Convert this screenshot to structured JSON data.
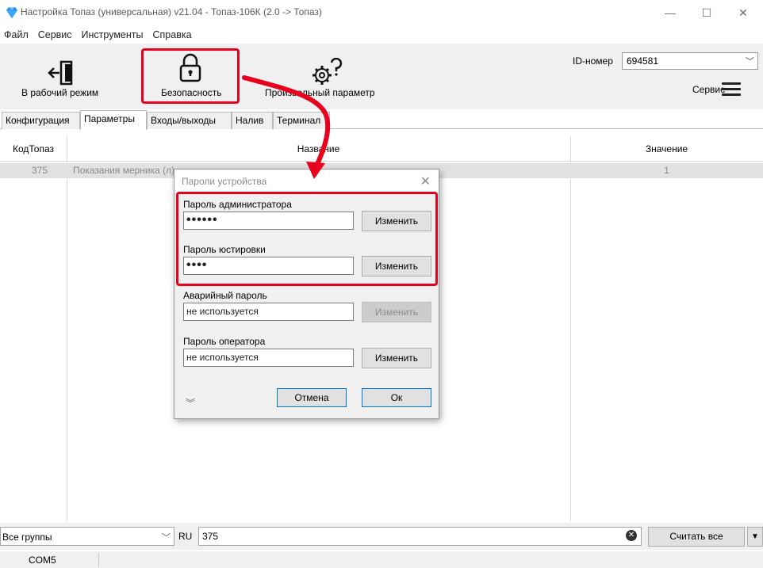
{
  "window": {
    "title": "Настройка Топаз (универсальная) v21.04 - Топаз-106К (2.0 -> Топаз)",
    "controls": {
      "minimize": "—",
      "maximize": "☐",
      "close": "✕"
    }
  },
  "menu": [
    "Файл",
    "Сервис",
    "Инструменты",
    "Справка"
  ],
  "toolbar": {
    "work_mode": "В рабочий режим",
    "security": "Безопасность",
    "custom_param": "Произвольный параметр",
    "id_label": "ID-номер",
    "id_value": "694581",
    "service": "Сервис"
  },
  "tabs": [
    "Конфигурация",
    "Параметры",
    "Входы/выходы",
    "Налив",
    "Терминал"
  ],
  "active_tab": "Параметры",
  "table": {
    "headers": [
      "КодТопаз",
      "Название",
      "Значение"
    ],
    "rows": [
      {
        "code": "375",
        "name": "Показания мерника (л)",
        "value": "1"
      }
    ]
  },
  "filter": {
    "group": "Все группы",
    "lang": "RU",
    "search": "375",
    "read_all": "Считать все"
  },
  "status": {
    "port": "COM5"
  },
  "dialog": {
    "title": "Пароли устройства",
    "admin_label": "Пароль администратора",
    "admin_value": "••••••",
    "adjust_label": "Пароль юстировки",
    "adjust_value": "••••",
    "emergency_label": "Аварийный пароль",
    "emergency_value": "не используется",
    "operator_label": "Пароль оператора",
    "operator_value": "не используется",
    "change": "Изменить",
    "cancel": "Отмена",
    "ok": "Ок"
  },
  "icons": {
    "app": "gem-icon",
    "work_mode": "exit-door-icon",
    "security": "padlock-icon",
    "custom_param": "gear-question-icon",
    "service": "hamburger-menu-icon",
    "clear": "clear-circle-icon",
    "expand": "double-chevron-down-icon"
  },
  "colors": {
    "highlight": "#e8001c",
    "gem": "#1e90ff",
    "focus_border": "#0078d7",
    "toolbar_bg": "#f0f0f0",
    "row_bg": "#e1e1e1"
  }
}
